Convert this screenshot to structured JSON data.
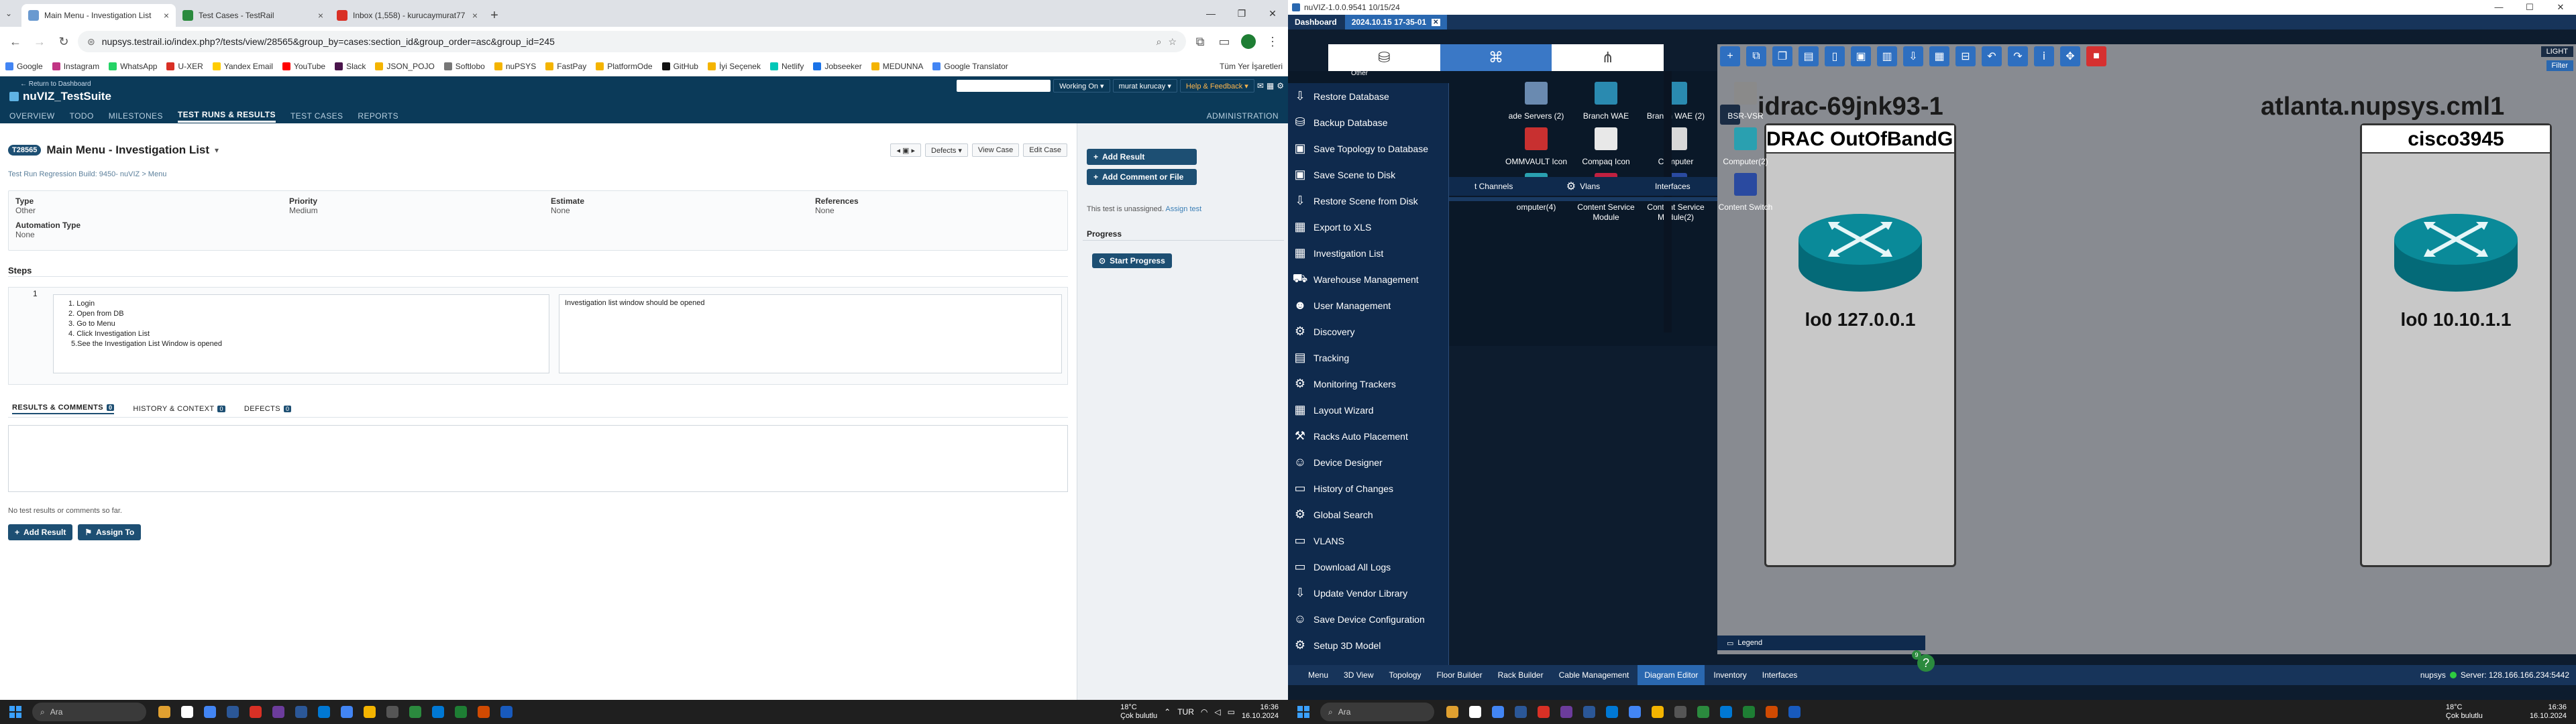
{
  "browser": {
    "tabs": [
      {
        "label": "Main Menu - Investigation List",
        "fav": "#6a9ad0",
        "active": true
      },
      {
        "label": "Test Cases - TestRail",
        "fav": "#2b8a3e",
        "active": false
      },
      {
        "label": "Inbox (1,558) - kurucaymurat77",
        "fav": "#d93025",
        "active": false
      }
    ],
    "url": "nupsys.testrail.io/index.php?/tests/view/28565&group_by=cases:section_id&group_order=asc&group_id=245",
    "bookmarks": [
      {
        "label": "Google",
        "c": "#4285f4"
      },
      {
        "label": "Instagram",
        "c": "#c13584"
      },
      {
        "label": "WhatsApp",
        "c": "#25d366"
      },
      {
        "label": "U-XER",
        "c": "#d93025"
      },
      {
        "label": "Yandex Email",
        "c": "#ffcc00"
      },
      {
        "label": "YouTube",
        "c": "#ff0000"
      },
      {
        "label": "Slack",
        "c": "#4a154b"
      },
      {
        "label": "JSON_POJO",
        "c": "#f4b400"
      },
      {
        "label": "Softlobo",
        "c": "#777777"
      },
      {
        "label": "nuPSYS",
        "c": "#f4b400"
      },
      {
        "label": "FastPay",
        "c": "#f4b400"
      },
      {
        "label": "PlatformOde",
        "c": "#f4b400"
      },
      {
        "label": "GitHub",
        "c": "#111111"
      },
      {
        "label": "İyi Seçenek",
        "c": "#f4b400"
      },
      {
        "label": "Netlify",
        "c": "#00c7b7"
      },
      {
        "label": "Jobseeker",
        "c": "#1a73e8"
      },
      {
        "label": "MEDUNNA",
        "c": "#f4b400"
      },
      {
        "label": "Google Translator",
        "c": "#4285f4"
      }
    ],
    "all_bookmarks": "Tüm Yer İşaretleri"
  },
  "testrail": {
    "return_link": "← Return to Dashboard",
    "project": "nuVIZ_TestSuite",
    "search_placeholder": "",
    "working_on": "Working On ▾",
    "user": "murat kurucay ▾",
    "help": "Help & Feedback ▾",
    "nav": [
      "OVERVIEW",
      "TODO",
      "MILESTONES",
      "TEST RUNS & RESULTS",
      "TEST CASES",
      "REPORTS"
    ],
    "admin": "ADMINISTRATION",
    "test_id": "T28565",
    "title": "Main Menu - Investigation List",
    "crumb": "Test Run Regression Build: 9450- nuVIZ > Menu",
    "defects_btn": "Defects ▾",
    "view_case": "View Case",
    "edit_case": "Edit Case",
    "fields": [
      {
        "label": "Type",
        "value": "Other"
      },
      {
        "label": "Priority",
        "value": "Medium"
      },
      {
        "label": "Estimate",
        "value": "None"
      },
      {
        "label": "References",
        "value": "None"
      }
    ],
    "automation_label": "Automation Type",
    "automation_value": "None",
    "steps_label": "Steps",
    "step_num": "1",
    "step_lines": [
      "1. Login",
      "2. Open from DB",
      "3. Go to Menu",
      "4. Click Investigation List",
      "5.See the Investigation List Window is opened"
    ],
    "expected": "Investigation list window should be opened",
    "result_tabs": [
      {
        "label": "RESULTS & COMMENTS",
        "count": "0"
      },
      {
        "label": "HISTORY & CONTEXT",
        "count": "0"
      },
      {
        "label": "DEFECTS",
        "count": "0"
      }
    ],
    "no_results": "No test results or comments so far.",
    "add_result": "Add Result",
    "assign_to": "Assign To",
    "side_add_result": "Add Result",
    "side_add_comment": "Add Comment or File",
    "unassigned": "This test is unassigned.",
    "assign_test": "Assign test",
    "progress": "Progress",
    "start_progress": "Start Progress"
  },
  "taskbar_left": {
    "search": "Ara",
    "weather_temp": "18°C",
    "weather_desc": "Çok bulutlu",
    "lang": "TUR",
    "time": "16:36",
    "date": "16.10.2024"
  },
  "nuviz": {
    "window_title": "nuVIZ-1.0.0.9541 10/15/24",
    "tabs": [
      {
        "label": "Dashboard",
        "sel": false
      },
      {
        "label": "2024.10.15 17-35-01",
        "sel": true
      }
    ],
    "light": "LIGHT",
    "filter": "Filter",
    "menu_items": [
      {
        "label": "Restore Database",
        "icon": "download"
      },
      {
        "label": "Backup Database",
        "icon": "db"
      },
      {
        "label": "Save Topology to Database",
        "icon": "save"
      },
      {
        "label": "Save Scene to Disk",
        "icon": "save"
      },
      {
        "label": "Restore Scene from Disk",
        "icon": "download"
      },
      {
        "label": "Export to XLS",
        "icon": "xls"
      },
      {
        "label": "Investigation List",
        "icon": "xls"
      },
      {
        "label": "Warehouse Management",
        "icon": "truck"
      },
      {
        "label": "User Management",
        "icon": "user"
      },
      {
        "label": "Discovery",
        "icon": "gear"
      },
      {
        "label": "Tracking",
        "icon": "clipboard"
      },
      {
        "label": "Monitoring Trackers",
        "icon": "gear"
      },
      {
        "label": "Layout Wizard",
        "icon": "grid"
      },
      {
        "label": "Racks Auto Placement",
        "icon": "wand"
      },
      {
        "label": "Device Designer",
        "icon": "people"
      },
      {
        "label": "History of Changes",
        "icon": "log"
      },
      {
        "label": "Global Search",
        "icon": "gear"
      },
      {
        "label": "VLANS",
        "icon": "log"
      },
      {
        "label": "Download All Logs",
        "icon": "log"
      },
      {
        "label": "Update Vendor Library",
        "icon": "download"
      },
      {
        "label": "Save Device Configuration",
        "icon": "people"
      },
      {
        "label": "Setup 3D Model",
        "icon": "gear"
      }
    ],
    "library": [
      {
        "label": "ade Servers (2)",
        "col": 0,
        "row": 0
      },
      {
        "label": "Branch WAE",
        "col": 1,
        "row": 0
      },
      {
        "label": "Branch WAE (2)",
        "col": 2,
        "row": 0
      },
      {
        "label": "BSR-VSR",
        "col": 3,
        "row": 0
      },
      {
        "label": "OMMVAULT Icon",
        "col": 0,
        "row": 1
      },
      {
        "label": "Compaq Icon",
        "col": 1,
        "row": 1
      },
      {
        "label": "Computer",
        "col": 2,
        "row": 1
      },
      {
        "label": "Computer(2)",
        "col": 3,
        "row": 1
      },
      {
        "label": "omputer(4)",
        "col": 0,
        "row": 2
      },
      {
        "label": "Content Service Module",
        "col": 1,
        "row": 2
      },
      {
        "label": "Content Service Module(2)",
        "col": 2,
        "row": 2
      },
      {
        "label": "Content Switch",
        "col": 3,
        "row": 2
      }
    ],
    "lib_tabs": [
      "t Channels",
      "Vlans",
      "Interfaces"
    ],
    "other_label": "Other",
    "devices": [
      {
        "name": "idrac-69jnk93-1",
        "card_title": "DRAC OutOfBandGr",
        "ip": "lo0  127.0.0.1"
      },
      {
        "name": "atlanta.nupsys.cml1",
        "card_title": "cisco3945",
        "ip": "lo0  10.10.1.1"
      }
    ],
    "legend": "Legend",
    "bottom_tabs": [
      {
        "label": "Menu",
        "sel": false
      },
      {
        "label": "3D View",
        "sel": false
      },
      {
        "label": "Topology",
        "sel": false
      },
      {
        "label": "Floor Builder",
        "sel": false
      },
      {
        "label": "Rack Builder",
        "sel": false
      },
      {
        "label": "Cable Management",
        "sel": false
      },
      {
        "label": "Diagram Editor",
        "sel": true
      },
      {
        "label": "Inventory",
        "sel": false
      },
      {
        "label": "Interfaces",
        "sel": false
      }
    ],
    "status_user": "nupsys",
    "status_server": "Server: 128.166.166.234:5442",
    "badge": "9"
  },
  "taskbar_right": {
    "search": "Ara",
    "weather_temp": "18°C",
    "weather_desc": "Çok bulutlu",
    "time": "16:36",
    "date": "16.10.2024"
  }
}
